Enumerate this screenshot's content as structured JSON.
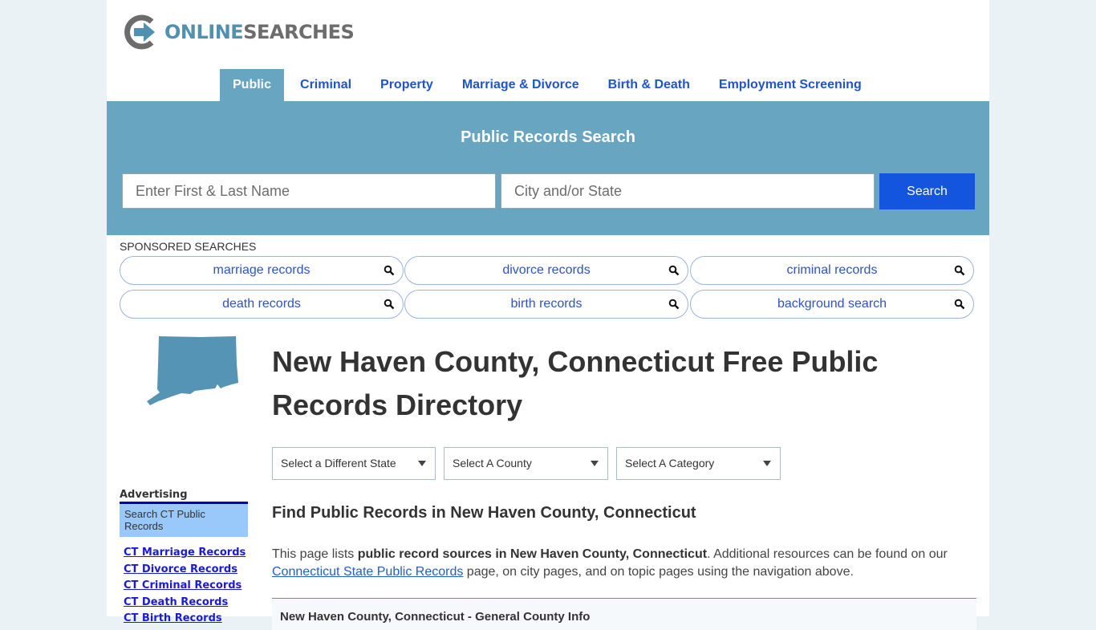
{
  "logo": {
    "part1": "ONLINE",
    "part2": "SEARCHES",
    "icon": "logo-arrow-icon"
  },
  "nav": {
    "items": [
      {
        "label": "Public",
        "active": true
      },
      {
        "label": "Criminal"
      },
      {
        "label": "Property"
      },
      {
        "label": "Marriage & Divorce"
      },
      {
        "label": "Birth & Death"
      },
      {
        "label": "Employment Screening"
      }
    ]
  },
  "hero": {
    "title": "Public Records Search",
    "name_placeholder": "Enter First & Last Name",
    "city_placeholder": "City and/or State",
    "search_label": "Search"
  },
  "sponsored": {
    "label": "SPONSORED SEARCHES",
    "items": [
      "marriage records",
      "divorce records",
      "criminal records",
      "death records",
      "birth records",
      "background search"
    ],
    "icon": "search-icon"
  },
  "state_map": {
    "name": "Connecticut",
    "icon": "connecticut-map-icon"
  },
  "page_title": "New Haven County, Connecticut Free Public Records Directory",
  "selects": {
    "state": "Select a Different State",
    "county": "Select A County",
    "category": "Select A Category"
  },
  "sidebar": {
    "advertising_label": "Advertising",
    "ad_box": "Search CT Public Records",
    "links": [
      "CT Marriage Records",
      "CT Divorce Records",
      "CT Criminal Records",
      "CT Death Records",
      "CT Birth Records"
    ]
  },
  "section_heading": "Find Public Records in New Haven County, Connecticut",
  "intro": {
    "pre": "This page lists ",
    "bold": "public record sources in New Haven County, Connecticut",
    "mid": ". Additional resources can be found on our ",
    "link": "Connecticut State Public Records",
    "post": " page, on city pages, and on topic pages using the navigation above."
  },
  "info_box": {
    "title": "New Haven County, Connecticut - General County Info"
  },
  "colors": {
    "brand": "#68a5c1",
    "button": "#1455e0",
    "nav_link": "#1f55c8"
  }
}
